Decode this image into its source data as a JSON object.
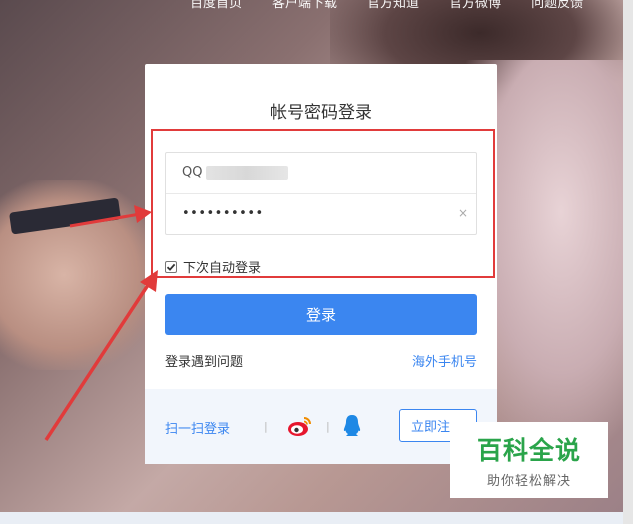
{
  "nav": {
    "items": [
      "百度首页",
      "客户端下载",
      "官方知道",
      "官方微博",
      "问题反馈"
    ]
  },
  "login": {
    "title": "帐号密码登录",
    "username_prefix": "QQ",
    "password_masked": "••••••••••",
    "clear_symbol": "×",
    "remember_label": "下次自动登录",
    "remember_checked": true,
    "submit_label": "登录",
    "problem_link": "登录遇到问题",
    "overseas_link": "海外手机号",
    "qr_login_label": "扫一扫登录",
    "separator": "|",
    "register_label": "立即注"
  },
  "watermark": {
    "title": "百科全说",
    "subtitle": "助你轻松解决"
  },
  "colors": {
    "accent": "#3b86f0",
    "annotation": "#e13b3b",
    "watermark_green": "#2aa44a"
  },
  "icons": [
    "weibo-icon",
    "qq-icon",
    "checkmark-icon",
    "clear-icon"
  ]
}
